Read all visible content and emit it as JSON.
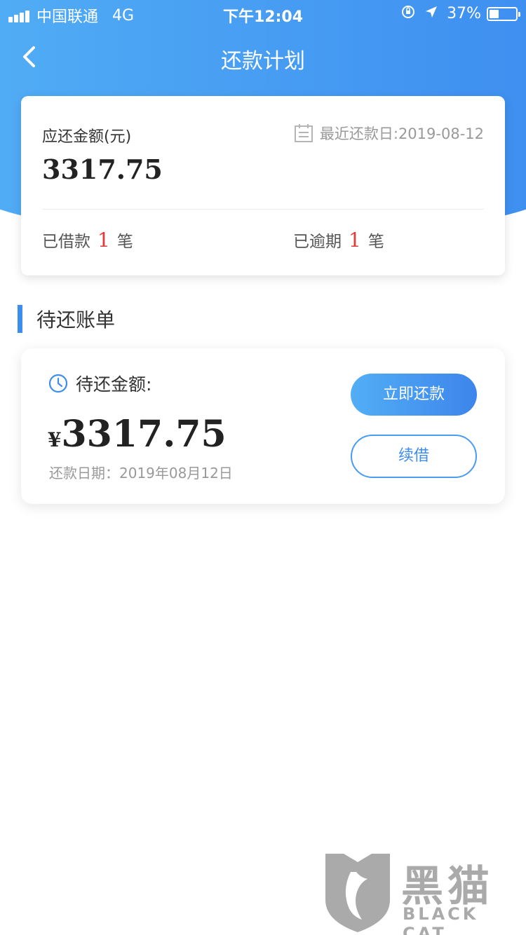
{
  "status_bar": {
    "carrier": "中国联通",
    "network": "4G",
    "time": "下午12:04",
    "battery": "37%",
    "battery_level": 0.37,
    "icons": [
      "signal-icon",
      "orientation-lock-icon",
      "location-arrow-icon",
      "battery-icon"
    ]
  },
  "nav": {
    "title": "还款计划",
    "back_icon": "chevron-left-icon"
  },
  "summary": {
    "due_label": "应还金额(元)",
    "due_amount": "3317.75",
    "next_date": "最近还款日:2019-08-12",
    "calendar_icon": "calendar-icon",
    "borrowed_prefix": "已借款",
    "borrowed_count": "1",
    "borrowed_suffix": "笔",
    "overdue_prefix": "已逾期",
    "overdue_count": "1",
    "overdue_suffix": "笔",
    "count_color": "#e23a3a"
  },
  "section": {
    "title": "待还账单",
    "accent": "#3d8df0"
  },
  "bill": {
    "label": "待还金额:",
    "clock_icon": "clock-icon",
    "currency": "¥",
    "amount": "3317.75",
    "date": "还款日期：2019年08月12日",
    "pay_label": "立即还款",
    "renew_label": "续借"
  },
  "watermark": {
    "chinese": "黑猫",
    "english": "BLACK CAT"
  },
  "colors": {
    "brand_blue": "#3d8df0",
    "brand_light_blue": "#52aef5"
  }
}
